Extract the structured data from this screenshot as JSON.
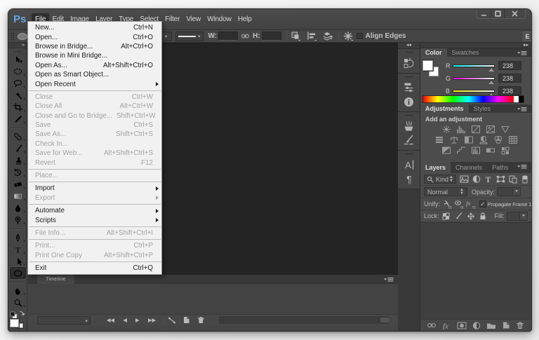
{
  "logo": "Ps",
  "window_controls": [
    {
      "name": "minimize",
      "glyph": "minimize-icon"
    },
    {
      "name": "maximize",
      "glyph": "maximize-icon"
    },
    {
      "name": "close",
      "glyph": "close-icon"
    }
  ],
  "menubar": {
    "items": [
      "File",
      "Edit",
      "Image",
      "Layer",
      "Type",
      "Select",
      "Filter",
      "View",
      "Window",
      "Help"
    ],
    "active": "File"
  },
  "file_menu": {
    "items": [
      {
        "label": "New...",
        "shortcut": "Ctrl+N",
        "enabled": true
      },
      {
        "label": "Open...",
        "shortcut": "Ctrl+O",
        "enabled": true
      },
      {
        "label": "Browse in Bridge...",
        "shortcut": "Alt+Ctrl+O",
        "enabled": true
      },
      {
        "label": "Browse in Mini Bridge...",
        "shortcut": "",
        "enabled": true
      },
      {
        "label": "Open As...",
        "shortcut": "Alt+Shift+Ctrl+O",
        "enabled": true
      },
      {
        "label": "Open as Smart Object...",
        "shortcut": "",
        "enabled": true
      },
      {
        "label": "Open Recent",
        "shortcut": "",
        "enabled": true,
        "submenu": true,
        "sep_after": true
      },
      {
        "label": "Close",
        "shortcut": "Ctrl+W",
        "enabled": false
      },
      {
        "label": "Close All",
        "shortcut": "Alt+Ctrl+W",
        "enabled": false
      },
      {
        "label": "Close and Go to Bridge...",
        "shortcut": "Shift+Ctrl+W",
        "enabled": false
      },
      {
        "label": "Save",
        "shortcut": "Ctrl+S",
        "enabled": false
      },
      {
        "label": "Save As...",
        "shortcut": "Shift+Ctrl+S",
        "enabled": false
      },
      {
        "label": "Check In...",
        "shortcut": "",
        "enabled": false
      },
      {
        "label": "Save for Web...",
        "shortcut": "Alt+Shift+Ctrl+S",
        "enabled": false
      },
      {
        "label": "Revert",
        "shortcut": "F12",
        "enabled": false,
        "sep_after": true
      },
      {
        "label": "Place...",
        "shortcut": "",
        "enabled": false,
        "sep_after": true
      },
      {
        "label": "Import",
        "shortcut": "",
        "enabled": true,
        "submenu": true
      },
      {
        "label": "Export",
        "shortcut": "",
        "enabled": false,
        "submenu": true,
        "sep_after": true
      },
      {
        "label": "Automate",
        "shortcut": "",
        "enabled": true,
        "submenu": true
      },
      {
        "label": "Scripts",
        "shortcut": "",
        "enabled": true,
        "submenu": true,
        "sep_after": true
      },
      {
        "label": "File Info...",
        "shortcut": "Alt+Shift+Ctrl+I",
        "enabled": false,
        "sep_after": true
      },
      {
        "label": "Print...",
        "shortcut": "Ctrl+P",
        "enabled": false
      },
      {
        "label": "Print One Copy",
        "shortcut": "Alt+Shift+Ctrl+P",
        "enabled": false,
        "sep_after": true
      },
      {
        "label": "Exit",
        "shortcut": "Ctrl+Q",
        "enabled": true
      }
    ]
  },
  "options_bar": {
    "tool_preset": "ellipse",
    "w_label": "W:",
    "w_value": "",
    "h_label": "H:",
    "h_value": "",
    "icons": [
      "path-operations",
      "path-alignment",
      "path-arrangement"
    ],
    "gear": "geometry-options",
    "align_edges": {
      "label": "Align Edges",
      "checked": false
    },
    "workspace_button": "E"
  },
  "toolbar": {
    "collapse_glyph": "»",
    "tools": [
      {
        "name": "move",
        "selected": false
      },
      {
        "name": "marquee",
        "selected": false,
        "group_start": false
      },
      {
        "name": "lasso",
        "selected": false
      },
      {
        "name": "quick-selection",
        "selected": false
      },
      {
        "name": "crop",
        "selected": false
      },
      {
        "name": "eyedropper",
        "selected": false,
        "sep_after": true
      },
      {
        "name": "healing-brush",
        "selected": false
      },
      {
        "name": "brush",
        "selected": false
      },
      {
        "name": "clone-stamp",
        "selected": false
      },
      {
        "name": "history-brush",
        "selected": false
      },
      {
        "name": "eraser",
        "selected": false
      },
      {
        "name": "gradient",
        "selected": false
      },
      {
        "name": "blur",
        "selected": false
      },
      {
        "name": "dodge",
        "selected": false,
        "sep_after": true
      },
      {
        "name": "pen",
        "selected": false
      },
      {
        "name": "type",
        "selected": false
      },
      {
        "name": "path-selection",
        "selected": false
      },
      {
        "name": "ellipse-shape",
        "selected": true,
        "sep_after": true
      },
      {
        "name": "hand",
        "selected": false
      },
      {
        "name": "zoom",
        "selected": false
      }
    ],
    "foreground_color": "#ffffff",
    "background_color": "#ffffff"
  },
  "dock_strip": {
    "collapse_glyph": "◂◂",
    "groups": [
      [
        "history"
      ],
      [
        "properties",
        "info"
      ],
      [
        "brush-presets",
        "clone-source"
      ],
      [
        "character",
        "paragraph"
      ]
    ]
  },
  "panels": {
    "expand_glyph": "▸▸",
    "color": {
      "tabs": [
        "Color",
        "Swatches"
      ],
      "active_tab": "Color",
      "channels": [
        {
          "label": "R",
          "value": "238"
        },
        {
          "label": "G",
          "value": "238"
        },
        {
          "label": "B",
          "value": "238"
        }
      ],
      "slider_fraction": 0.933,
      "gradients": [
        [
          "#00eeee",
          "#ffeeee"
        ],
        [
          "#ee00ee",
          "#eeffee"
        ],
        [
          "#eeee00",
          "#eeeeff"
        ]
      ]
    },
    "adjustments": {
      "tabs": [
        "Adjustments",
        "Styles"
      ],
      "active_tab": "Adjustments",
      "heading": "Add an adjustment",
      "icon_rows": [
        [
          "brightness-contrast",
          "levels",
          "curves",
          "exposure",
          "vibrance"
        ],
        [
          "hue-saturation",
          "color-balance",
          "black-white",
          "photo-filter",
          "channel-mixer",
          "color-lookup"
        ],
        [
          "invert",
          "posterize",
          "threshold",
          "gradient-map",
          "selective-color"
        ]
      ]
    },
    "layers": {
      "tabs": [
        "Layers",
        "Channels",
        "Paths"
      ],
      "active_tab": "Layers",
      "filter": {
        "search_label": "Kind",
        "icons": [
          "filter-image",
          "filter-adjustment",
          "filter-type",
          "filter-shape",
          "filter-smart-object"
        ],
        "toggle": "filter-switch"
      },
      "blend_mode": "Normal",
      "opacity_label": "Opacity:",
      "opacity_value": "",
      "unify": {
        "label": "Unify:",
        "icons": [
          "unify-position",
          "unify-visibility",
          "unify-style"
        ]
      },
      "propagate": {
        "label": "Propagate Frame 1",
        "checked": true
      },
      "lock": {
        "label": "Lock:",
        "icons": [
          "lock-transparency",
          "lock-pixels",
          "lock-position",
          "lock-all"
        ]
      },
      "fill_label": "Fill:",
      "fill_value": "",
      "bottom_icons": [
        "link-layers",
        "layer-style-fx",
        "layer-mask",
        "new-adjustment",
        "new-group",
        "new-layer",
        "delete-layer"
      ]
    }
  },
  "timeline": {
    "tab": "Timeline",
    "loop_value": "",
    "transport": [
      "first-frame",
      "previous-frame",
      "play",
      "next-frame"
    ],
    "frame_tools": [
      "tween",
      "duplicate-frame",
      "delete-frame"
    ]
  }
}
